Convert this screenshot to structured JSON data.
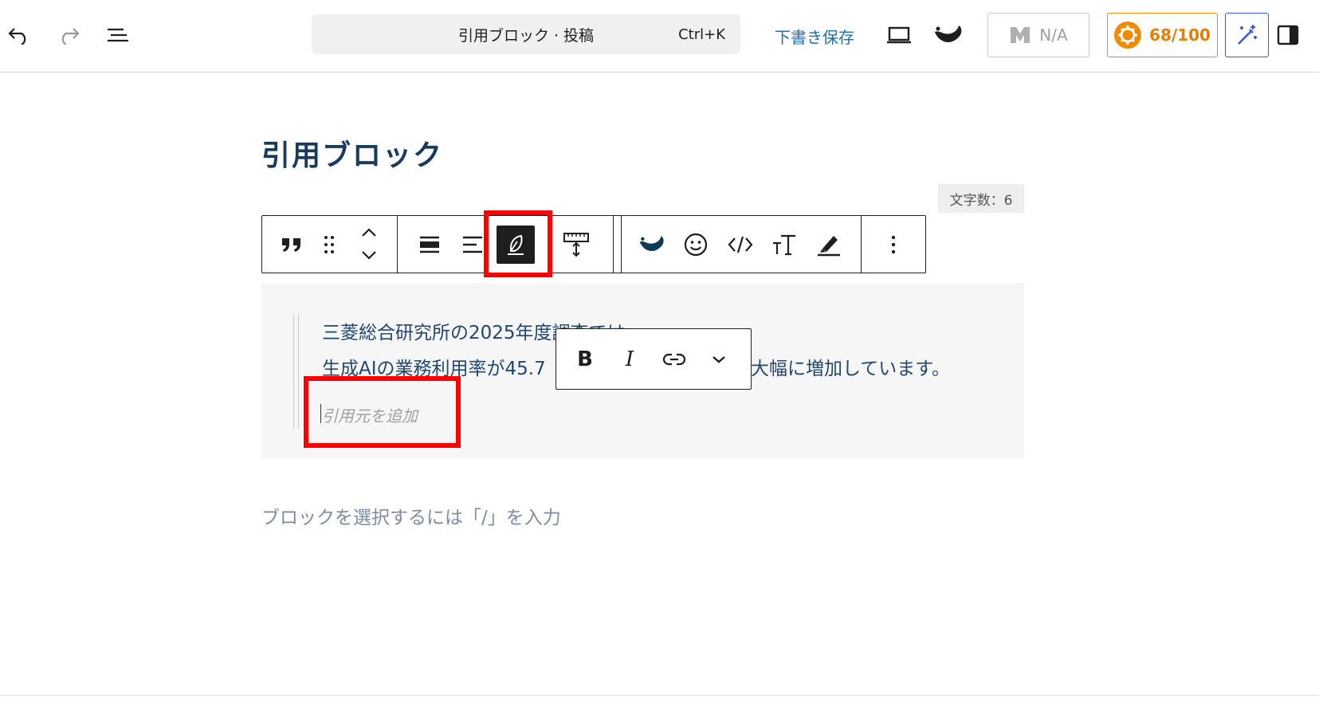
{
  "topbar": {
    "icons": [
      "undo-icon",
      "redo-icon",
      "document-overview-icon",
      "desktop-preview-icon",
      "plugin-logo-icon",
      "sidebar-toggle-icon"
    ],
    "command_title": "引用ブロック · 投稿",
    "command_shortcut": "Ctrl+K",
    "save_draft": "下書き保存",
    "seo_status": "N/A",
    "score": "68/100",
    "accent_color": "#2271b1",
    "score_color": "#e67e00"
  },
  "post": {
    "title": "引用ブロック",
    "char_count": "文字数：6"
  },
  "block_toolbar": {
    "buttons": [
      "quote-icon",
      "drag-handle-icon",
      "move-up-icon",
      "move-down-icon",
      "align-center-icon",
      "align-left-icon",
      "feather-icon",
      "block-height-icon",
      "plugin-logo-icon",
      "emoji-icon",
      "code-icon",
      "text-size-icon",
      "highlight-icon",
      "more-options-icon"
    ],
    "active": "feather-icon"
  },
  "quote": {
    "line1": "三菱総合研究所の2025年度調査では",
    "line2_start": "生成AIの業務利用率が45.7",
    "line2_end": "大幅に増加しています。",
    "citation_placeholder": "引用元を追加"
  },
  "format_toolbar": {
    "bold": "B",
    "italic": "I"
  },
  "appender": {
    "placeholder": "ブロックを選択するには「/」を入力"
  },
  "highlight_color": "#ff0000"
}
